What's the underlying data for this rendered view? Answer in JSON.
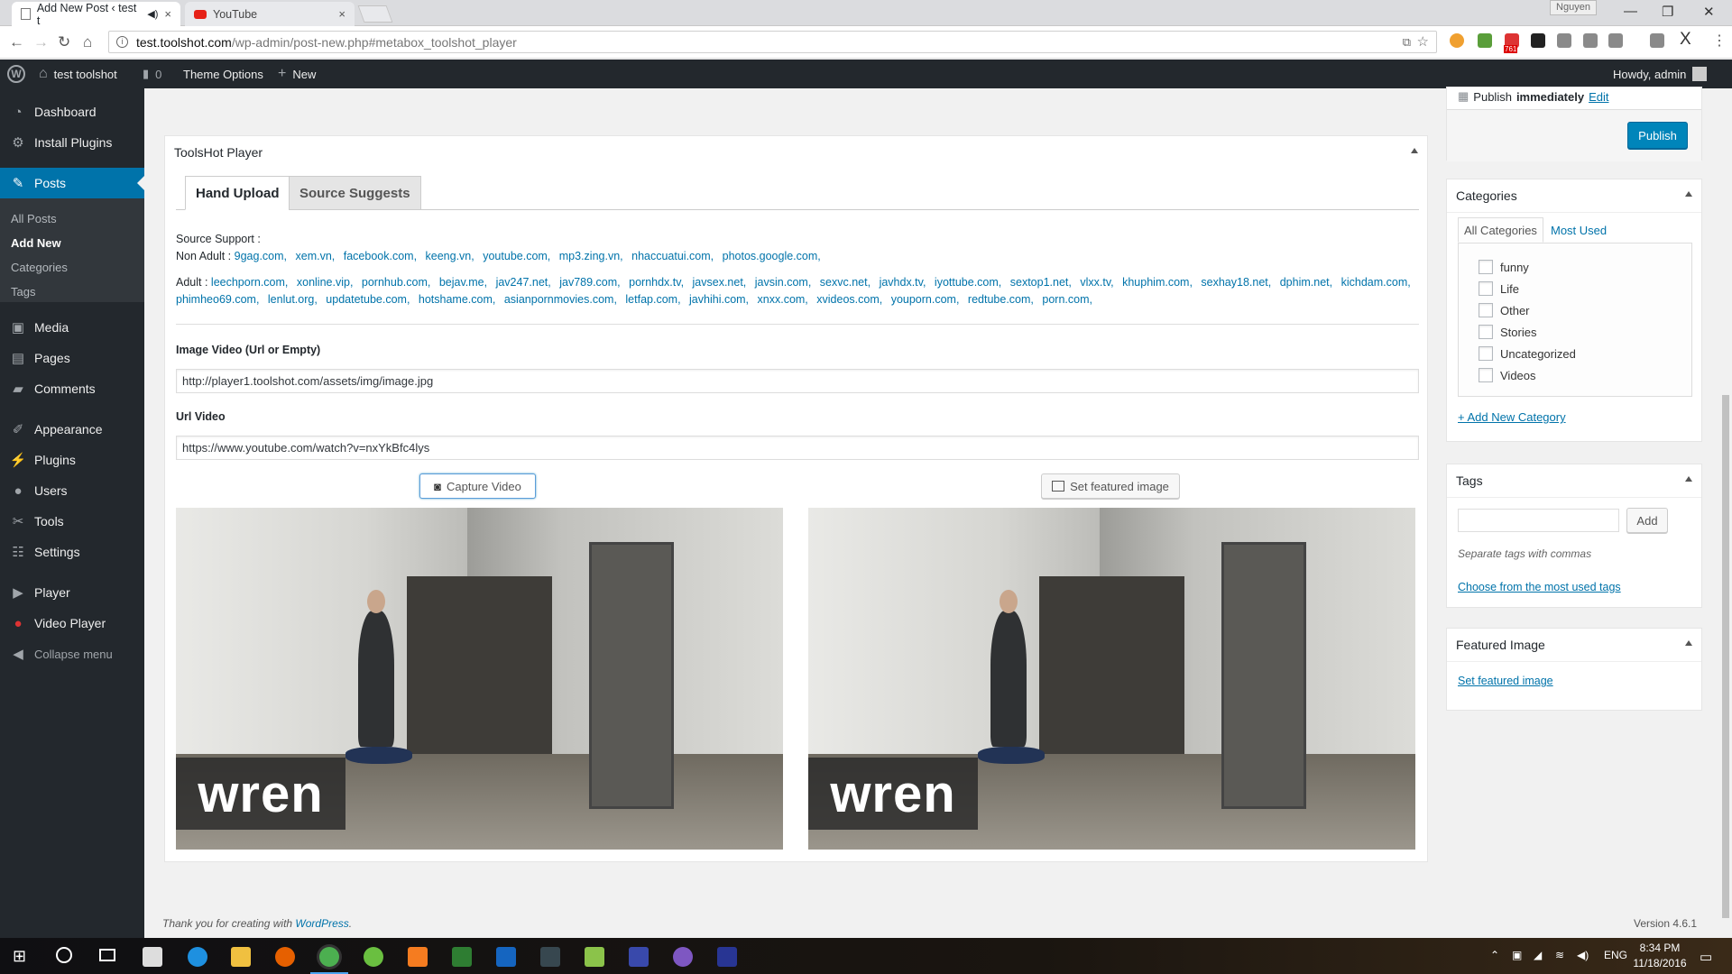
{
  "browser": {
    "tabs": [
      {
        "title": "Add New Post ‹ test t",
        "close": "×"
      },
      {
        "title": "YouTube",
        "close": "×"
      }
    ],
    "profile_name": "Nguyen",
    "url_host": "test.toolshot.com",
    "url_path": "/wp-admin/post-new.php#metabox_toolshot_player",
    "ext_badge": "761"
  },
  "adminbar": {
    "site_name": "test toolshot",
    "comments_count": "0",
    "theme_options": "Theme Options",
    "new_label": "New",
    "howdy": "Howdy, admin"
  },
  "sidebar": {
    "items": [
      {
        "label": "Dashboard",
        "icon": "dashboard-icon"
      },
      {
        "label": "Install Plugins",
        "icon": "gear-icon"
      },
      {
        "label": "Posts",
        "icon": "pin-icon"
      },
      {
        "label": "Media",
        "icon": "media-icon"
      },
      {
        "label": "Pages",
        "icon": "page-icon"
      },
      {
        "label": "Comments",
        "icon": "comment-icon"
      },
      {
        "label": "Appearance",
        "icon": "brush-icon"
      },
      {
        "label": "Plugins",
        "icon": "plug-icon"
      },
      {
        "label": "Users",
        "icon": "user-icon"
      },
      {
        "label": "Tools",
        "icon": "wrench-icon"
      },
      {
        "label": "Settings",
        "icon": "settings-icon"
      },
      {
        "label": "Player",
        "icon": "play-icon"
      },
      {
        "label": "Video Player",
        "icon": "video-icon"
      },
      {
        "label": "Collapse menu",
        "icon": "collapse-icon"
      }
    ],
    "submenu": [
      "All Posts",
      "Add New",
      "Categories",
      "Tags"
    ]
  },
  "player_box": {
    "title": "ToolsHot Player",
    "tabs": [
      "Hand Upload",
      "Source Suggests"
    ],
    "source_support": "Source Support :",
    "non_adult_label": "Non Adult :",
    "non_adult": [
      "9gag.com,",
      "xem.vn,",
      "facebook.com,",
      "keeng.vn,",
      "youtube.com,",
      "mp3.zing.vn,",
      "nhaccuatui.com,",
      "photos.google.com,"
    ],
    "adult_label": "Adult :",
    "adult": [
      "leechporn.com,",
      "xonline.vip,",
      "pornhub.com,",
      "bejav.me,",
      "jav247.net,",
      "jav789.com,",
      "pornhdx.tv,",
      "javsex.net,",
      "javsin.com,",
      "sexvc.net,",
      "javhdx.tv,",
      "iyottube.com,",
      "sextop1.net,",
      "vlxx.tv,",
      "khuphim.com,",
      "sexhay18.net,",
      "dphim.net,",
      "kichdam.com,",
      "phimheo69.com,",
      "lenlut.org,",
      "updatetube.com,",
      "hotshame.com,",
      "asianpornmovies.com,",
      "letfap.com,",
      "javhihi.com,",
      "xnxx.com,",
      "xvideos.com,",
      "youporn.com,",
      "redtube.com,",
      "porn.com,"
    ],
    "image_label": "Image Video (Url or Empty)",
    "image_value": "http://player1.toolshot.com/assets/img/image.jpg",
    "url_label": "Url Video",
    "url_value": "https://www.youtube.com/watch?v=nxYkBfc4lys",
    "capture_btn": "Capture Video",
    "featured_btn": "Set featured image",
    "watermark": "wren"
  },
  "publish": {
    "label": "Publish",
    "immediately": "immediately",
    "edit": "Edit",
    "button": "Publish"
  },
  "categories": {
    "title": "Categories",
    "tab_all": "All Categories",
    "tab_most": "Most Used",
    "items": [
      "funny",
      "Life",
      "Other",
      "Stories",
      "Uncategorized",
      "Videos"
    ],
    "add_new": "+ Add New Category"
  },
  "tags": {
    "title": "Tags",
    "add": "Add",
    "hint": "Separate tags with commas",
    "choose": "Choose from the most used tags"
  },
  "featured": {
    "title": "Featured Image",
    "link": "Set featured image"
  },
  "footer": {
    "thanks": "Thank you for creating with ",
    "wp": "WordPress",
    "version": "Version 4.6.1"
  },
  "taskbar": {
    "lang": "ENG",
    "time": "8:34 PM",
    "date": "11/18/2016"
  }
}
